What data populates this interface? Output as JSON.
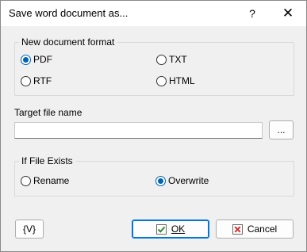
{
  "window": {
    "title": "Save word document as...",
    "help_glyph": "?",
    "close_glyph": "✕"
  },
  "format_group": {
    "label": "New document format",
    "options": [
      {
        "label": "PDF",
        "checked": true
      },
      {
        "label": "TXT",
        "checked": false
      },
      {
        "label": "RTF",
        "checked": false
      },
      {
        "label": "HTML",
        "checked": false
      }
    ]
  },
  "target": {
    "label": "Target file name",
    "value": "",
    "browse_label": "..."
  },
  "exists_group": {
    "label": "If File Exists",
    "options": [
      {
        "label": "Rename",
        "checked": false
      },
      {
        "label": "Overwrite",
        "checked": true
      }
    ]
  },
  "buttons": {
    "variables_label": "{V}",
    "ok_label": "OK",
    "cancel_label": "Cancel"
  },
  "icons": {
    "ok": "green-check-icon",
    "cancel": "red-x-icon"
  },
  "colors": {
    "accent": "#0063b1",
    "ok_icon": "#2e8b2e",
    "cancel_icon": "#d32f2f"
  }
}
